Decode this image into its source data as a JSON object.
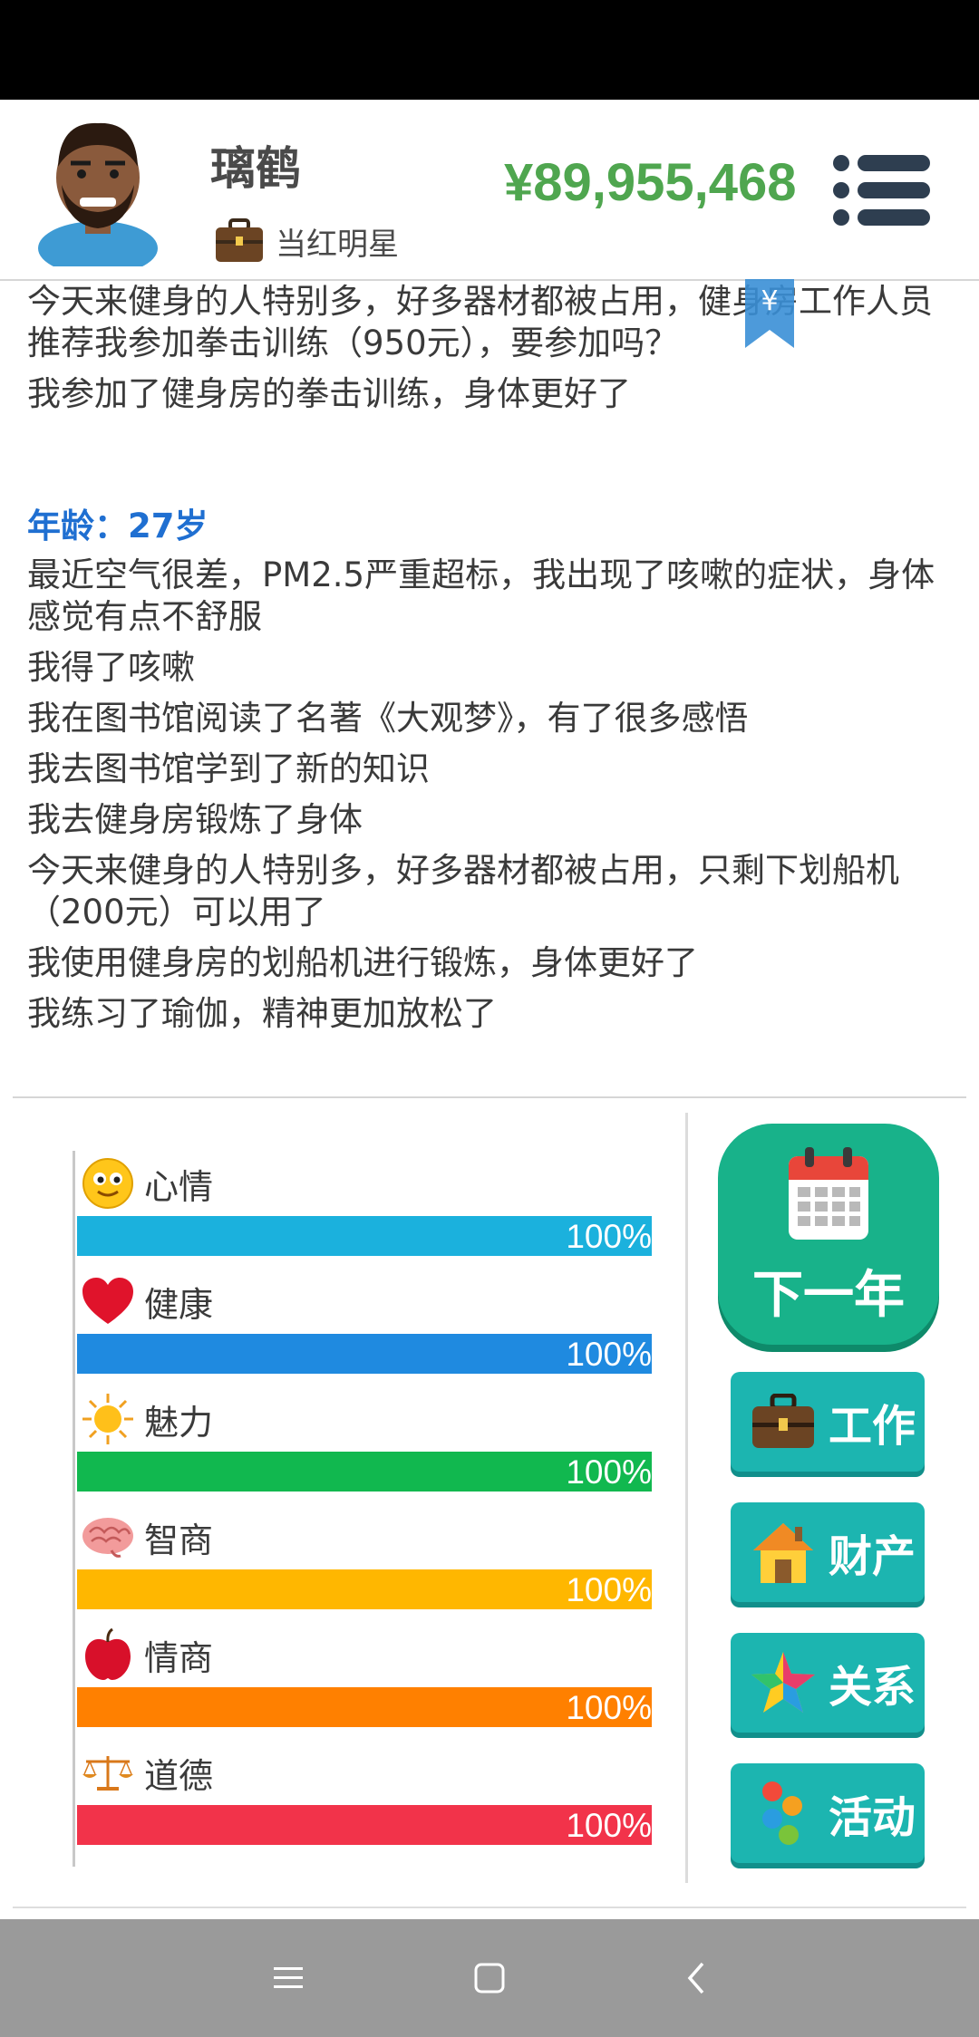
{
  "player": {
    "name": "璃鹤",
    "job": "当红明星",
    "money": "¥89,955,468"
  },
  "log": {
    "entries_before": [
      "今天来健身的人特别多，好多器材都被占用，健身房工作人员推荐我参加拳击训练（950元），要参加吗？",
      "我参加了健身房的拳击训练，身体更好了"
    ],
    "age_label": "年龄：27岁",
    "entries": [
      "最近空气很差，PM2.5严重超标，我出现了咳嗽的症状，身体感觉有点不舒服",
      "我得了咳嗽",
      "我在图书馆阅读了名著《大观梦》，有了很多感悟",
      "我去图书馆学到了新的知识",
      "我去健身房锻炼了身体",
      "今天来健身的人特别多，好多器材都被占用，只剩下划船机（200元）可以用了",
      "我使用健身房的划船机进行锻炼，身体更好了",
      "我练习了瑜伽，精神更加放松了"
    ],
    "bookmark_symbol": "¥"
  },
  "stats": [
    {
      "label": "心情",
      "value": 100,
      "text": "100%",
      "color": "#1bb1dd",
      "icon": "smiley-face-icon"
    },
    {
      "label": "健康",
      "value": 100,
      "text": "100%",
      "color": "#1f8ae0",
      "icon": "heart-icon"
    },
    {
      "label": "魅力",
      "value": 100,
      "text": "100%",
      "color": "#11b84f",
      "icon": "sun-icon"
    },
    {
      "label": "智商",
      "value": 100,
      "text": "100%",
      "color": "#ffb700",
      "icon": "brain-icon"
    },
    {
      "label": "情商",
      "value": 100,
      "text": "100%",
      "color": "#ff8000",
      "icon": "apple-icon"
    },
    {
      "label": "道德",
      "value": 100,
      "text": "100%",
      "color": "#f2334a",
      "icon": "scales-icon"
    }
  ],
  "actions": {
    "next_year": "下一年",
    "work": "工作",
    "property": "财产",
    "relations": "关系",
    "activities": "活动"
  },
  "colors": {
    "money": "#4fa64f",
    "age": "#1f6fd1",
    "next_year_bg": "#18b28a",
    "side_button_bg": "#1cb5b0",
    "nav_bar": "#9a9a9a"
  }
}
